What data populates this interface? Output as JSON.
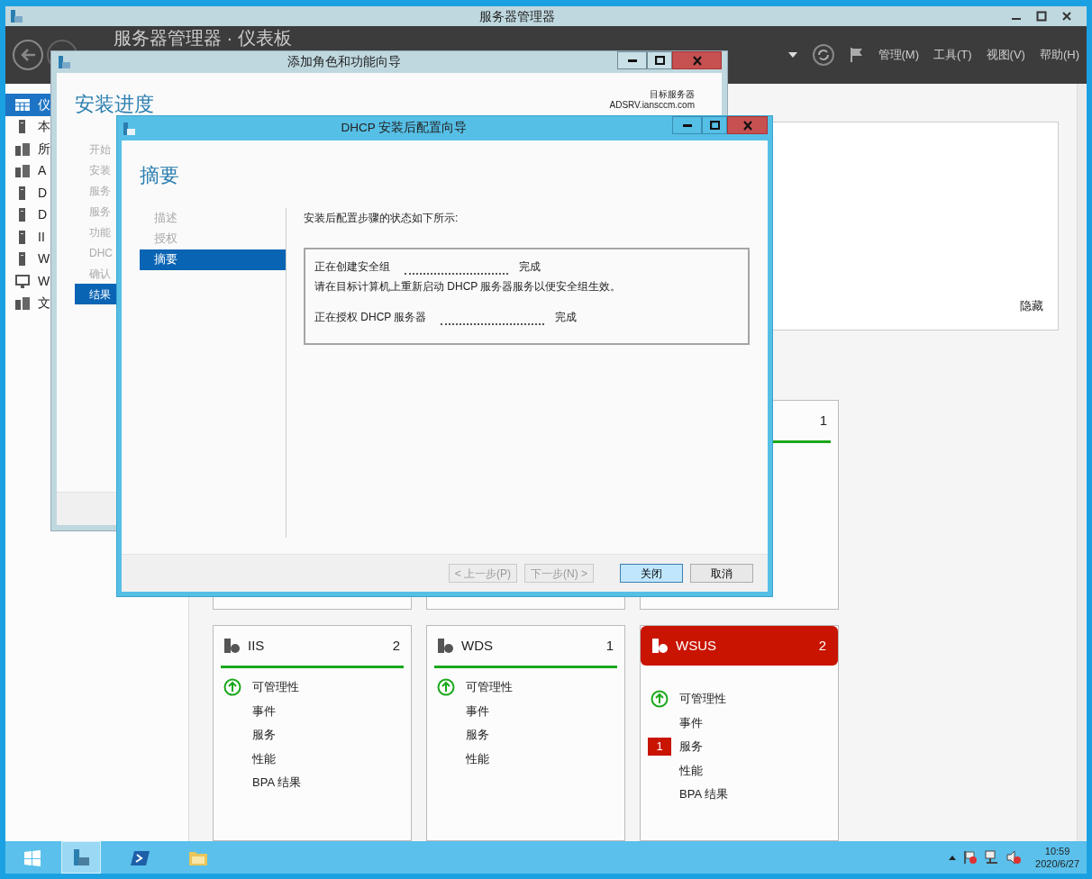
{
  "server_manager": {
    "title": "服务器管理器",
    "page_title": "服务器管理器 · 仪表板",
    "menu": [
      "管理(M)",
      "工具(T)",
      "视图(V)",
      "帮助(H)"
    ],
    "sidebar": [
      {
        "label": "仪",
        "selected": true
      },
      {
        "label": "本",
        "selected": false
      },
      {
        "label": "所",
        "selected": false
      },
      {
        "label": "A",
        "selected": false
      },
      {
        "label": "D",
        "selected": false
      },
      {
        "label": "D",
        "selected": false
      },
      {
        "label": "II",
        "selected": false
      },
      {
        "label": "W",
        "selected": false
      },
      {
        "label": "W",
        "selected": false
      },
      {
        "label": "文",
        "selected": false
      }
    ],
    "hide_link": "隐藏",
    "hidden_tile_count": "1",
    "tiles": [
      {
        "name": "IIS",
        "count": "2",
        "alert": false,
        "items": [
          {
            "label": "可管理性",
            "kind": "ok"
          },
          {
            "label": "事件",
            "kind": "plain"
          },
          {
            "label": "服务",
            "kind": "plain"
          },
          {
            "label": "性能",
            "kind": "plain"
          },
          {
            "label": "BPA 结果",
            "kind": "plain"
          }
        ]
      },
      {
        "name": "WDS",
        "count": "1",
        "alert": false,
        "items": [
          {
            "label": "可管理性",
            "kind": "ok"
          },
          {
            "label": "事件",
            "kind": "plain"
          },
          {
            "label": "服务",
            "kind": "plain"
          },
          {
            "label": "性能",
            "kind": "plain"
          }
        ]
      },
      {
        "name": "WSUS",
        "count": "2",
        "alert": true,
        "items": [
          {
            "label": "可管理性",
            "kind": "ok"
          },
          {
            "label": "事件",
            "kind": "plain"
          },
          {
            "label": "服务",
            "kind": "alert",
            "badge": "1"
          },
          {
            "label": "性能",
            "kind": "plain"
          },
          {
            "label": "BPA 结果",
            "kind": "plain"
          }
        ]
      }
    ]
  },
  "wizard_back": {
    "title": "添加角色和功能向导",
    "heading": "安装进度",
    "target_label": "目标服务器",
    "target_server": "ADSRV.iansccm.com",
    "steps": [
      {
        "label": "开始",
        "selected": false
      },
      {
        "label": "安装",
        "selected": false
      },
      {
        "label": "服务",
        "selected": false
      },
      {
        "label": "服务",
        "selected": false
      },
      {
        "label": "功能",
        "selected": false
      },
      {
        "label": "DHC",
        "selected": false
      },
      {
        "label": "确认",
        "selected": false
      },
      {
        "label": "结果",
        "selected": true
      }
    ]
  },
  "wizard_front": {
    "title": "DHCP 安装后配置向导",
    "heading": "摘要",
    "steps": [
      {
        "label": "描述",
        "selected": false
      },
      {
        "label": "授权",
        "selected": false
      },
      {
        "label": "摘要",
        "selected": true
      }
    ],
    "intro": "安装后配置步骤的状态如下所示:",
    "results": [
      {
        "kind": "step",
        "label": "正在创建安全组",
        "status": "完成"
      },
      {
        "kind": "note",
        "text": "请在目标计算机上重新启动 DHCP 服务器服务以便安全组生效。"
      },
      {
        "kind": "step",
        "label": "正在授权 DHCP 服务器",
        "status": "完成"
      }
    ],
    "buttons": [
      {
        "label": "< 上一步(P)",
        "disabled": true,
        "focused": false
      },
      {
        "label": "下一步(N) >",
        "disabled": true,
        "focused": false
      },
      {
        "label": "关闭",
        "disabled": false,
        "focused": true
      },
      {
        "label": "取消",
        "disabled": false,
        "focused": false
      }
    ]
  },
  "taskbar": {
    "apps": [
      {
        "kind": "start",
        "selected": false
      },
      {
        "kind": "server_manager",
        "selected": true
      },
      {
        "kind": "powershell",
        "selected": false
      },
      {
        "kind": "explorer",
        "selected": false
      }
    ],
    "time": "10:59",
    "date": "2020/6/27"
  }
}
